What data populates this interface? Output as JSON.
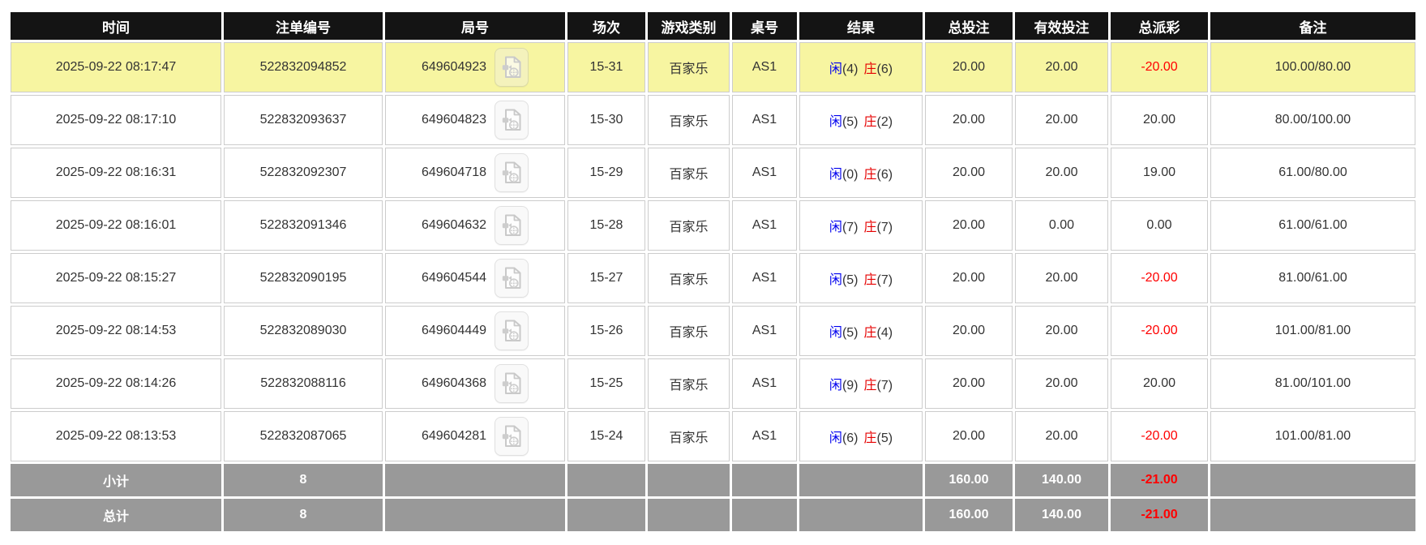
{
  "colors": {
    "header_bg": "#141414",
    "header_text": "#ffffff",
    "highlight_row_bg": "#f7f5a1",
    "summary_row_bg": "#999999",
    "total_bet_blue": "#0066ff",
    "negative_red": "#ff0000",
    "player_blue": "#0000ee",
    "banker_red": "#e60000",
    "cell_border": "#cccccc"
  },
  "icons": {
    "round_video": "video-file-icon"
  },
  "table": {
    "columns": [
      {
        "label": "时间"
      },
      {
        "label": "注单编号"
      },
      {
        "label": "局号"
      },
      {
        "label": "场次"
      },
      {
        "label": "游戏类别"
      },
      {
        "label": "桌号"
      },
      {
        "label": "结果"
      },
      {
        "label": "总投注"
      },
      {
        "label": "有效投注"
      },
      {
        "label": "总派彩"
      },
      {
        "label": "备注"
      }
    ],
    "rows": [
      {
        "time": "2025-09-22 08:17:47",
        "bet_id": "522832094852",
        "round_id": "649604923",
        "session": "15-31",
        "game_type": "百家乐",
        "table_no": "AS1",
        "result": {
          "player_label": "闲",
          "player_value": "(4)",
          "banker_label": "庄",
          "banker_value": "(6)"
        },
        "total_bet": "20.00",
        "valid_bet": "20.00",
        "payout": "-20.00",
        "remark": "100.00/80.00",
        "highlighted": true
      },
      {
        "time": "2025-09-22 08:17:10",
        "bet_id": "522832093637",
        "round_id": "649604823",
        "session": "15-30",
        "game_type": "百家乐",
        "table_no": "AS1",
        "result": {
          "player_label": "闲",
          "player_value": "(5)",
          "banker_label": "庄",
          "banker_value": "(2)"
        },
        "total_bet": "20.00",
        "valid_bet": "20.00",
        "payout": "20.00",
        "remark": "80.00/100.00",
        "highlighted": false
      },
      {
        "time": "2025-09-22 08:16:31",
        "bet_id": "522832092307",
        "round_id": "649604718",
        "session": "15-29",
        "game_type": "百家乐",
        "table_no": "AS1",
        "result": {
          "player_label": "闲",
          "player_value": "(0)",
          "banker_label": "庄",
          "banker_value": "(6)"
        },
        "total_bet": "20.00",
        "valid_bet": "20.00",
        "payout": "19.00",
        "remark": "61.00/80.00",
        "highlighted": false
      },
      {
        "time": "2025-09-22 08:16:01",
        "bet_id": "522832091346",
        "round_id": "649604632",
        "session": "15-28",
        "game_type": "百家乐",
        "table_no": "AS1",
        "result": {
          "player_label": "闲",
          "player_value": "(7)",
          "banker_label": "庄",
          "banker_value": "(7)"
        },
        "total_bet": "20.00",
        "valid_bet": "0.00",
        "payout": "0.00",
        "remark": "61.00/61.00",
        "highlighted": false
      },
      {
        "time": "2025-09-22 08:15:27",
        "bet_id": "522832090195",
        "round_id": "649604544",
        "session": "15-27",
        "game_type": "百家乐",
        "table_no": "AS1",
        "result": {
          "player_label": "闲",
          "player_value": "(5)",
          "banker_label": "庄",
          "banker_value": "(7)"
        },
        "total_bet": "20.00",
        "valid_bet": "20.00",
        "payout": "-20.00",
        "remark": "81.00/61.00",
        "highlighted": false
      },
      {
        "time": "2025-09-22 08:14:53",
        "bet_id": "522832089030",
        "round_id": "649604449",
        "session": "15-26",
        "game_type": "百家乐",
        "table_no": "AS1",
        "result": {
          "player_label": "闲",
          "player_value": "(5)",
          "banker_label": "庄",
          "banker_value": "(4)"
        },
        "total_bet": "20.00",
        "valid_bet": "20.00",
        "payout": "-20.00",
        "remark": "101.00/81.00",
        "highlighted": false
      },
      {
        "time": "2025-09-22 08:14:26",
        "bet_id": "522832088116",
        "round_id": "649604368",
        "session": "15-25",
        "game_type": "百家乐",
        "table_no": "AS1",
        "result": {
          "player_label": "闲",
          "player_value": "(9)",
          "banker_label": "庄",
          "banker_value": "(7)"
        },
        "total_bet": "20.00",
        "valid_bet": "20.00",
        "payout": "20.00",
        "remark": "81.00/101.00",
        "highlighted": false
      },
      {
        "time": "2025-09-22 08:13:53",
        "bet_id": "522832087065",
        "round_id": "649604281",
        "session": "15-24",
        "game_type": "百家乐",
        "table_no": "AS1",
        "result": {
          "player_label": "闲",
          "player_value": "(6)",
          "banker_label": "庄",
          "banker_value": "(5)"
        },
        "total_bet": "20.00",
        "valid_bet": "20.00",
        "payout": "-20.00",
        "remark": "101.00/81.00",
        "highlighted": false
      }
    ],
    "subtotal": {
      "label": "小计",
      "count": "8",
      "total_bet": "160.00",
      "valid_bet": "140.00",
      "payout": "-21.00",
      "remark": ""
    },
    "total": {
      "label": "总计",
      "count": "8",
      "total_bet": "160.00",
      "valid_bet": "140.00",
      "payout": "-21.00",
      "remark": ""
    }
  }
}
